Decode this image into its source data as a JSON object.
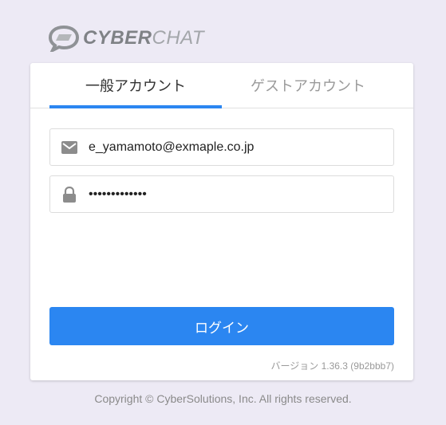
{
  "logo": {
    "bold_text": "CYBER",
    "light_text": "CHAT"
  },
  "tabs": [
    {
      "label": "一般アカウント",
      "active": true
    },
    {
      "label": "ゲストアカウント",
      "active": false
    }
  ],
  "form": {
    "email_value": "e_yamamoto@exmaple.co.jp",
    "password_value": "•••••••••••••",
    "login_label": "ログイン"
  },
  "version": "バージョン 1.36.3 (9b2bbb7)",
  "footer": {
    "copyright": "Copyright © CyberSolutions, Inc. All rights reserved."
  },
  "colors": {
    "accent": "#2b86f1",
    "background": "#edeaf5"
  }
}
